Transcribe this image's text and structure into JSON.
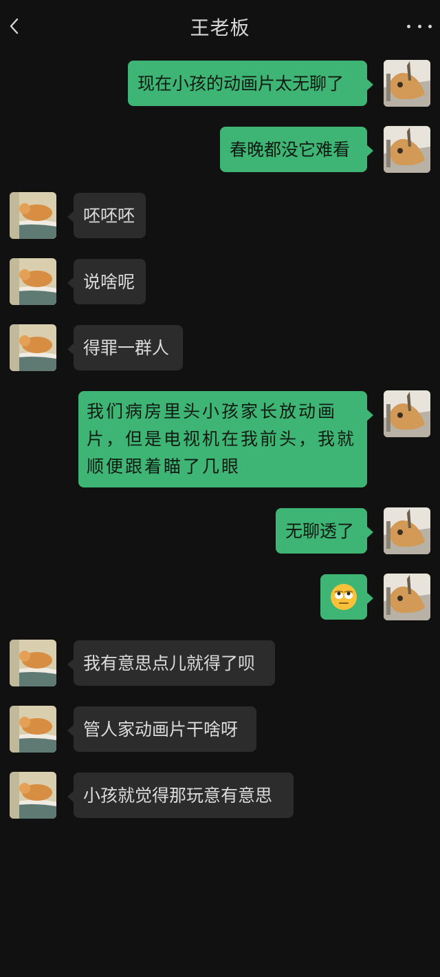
{
  "header": {
    "title": "王老板"
  },
  "messages": [
    {
      "side": "me",
      "text": "现在小孩的动画片太无聊了"
    },
    {
      "side": "me",
      "text": "春晚都没它难看"
    },
    {
      "side": "them",
      "text": "呸呸呸"
    },
    {
      "side": "them",
      "text": "说啥呢"
    },
    {
      "side": "them",
      "text": "得罪一群人"
    },
    {
      "side": "me",
      "text": "我们病房里头小孩家长放动画片，但是电视机在我前头，我就顺便跟着瞄了几眼"
    },
    {
      "side": "me",
      "text": "无聊透了"
    },
    {
      "side": "me",
      "emoji": "rolling-eyes-emoji"
    },
    {
      "side": "them",
      "text": "我有意思点儿就得了呗"
    },
    {
      "side": "them",
      "text": "管人家动画片干啥呀"
    },
    {
      "side": "them",
      "text": "小孩就觉得那玩意有意思"
    }
  ],
  "icons": {
    "back": "back-chevron-icon",
    "more": "more-dots-icon"
  },
  "colors": {
    "background": "#111111",
    "my_bubble": "#3eb575",
    "their_bubble": "#2c2c2c",
    "title": "#d6d6d6"
  }
}
